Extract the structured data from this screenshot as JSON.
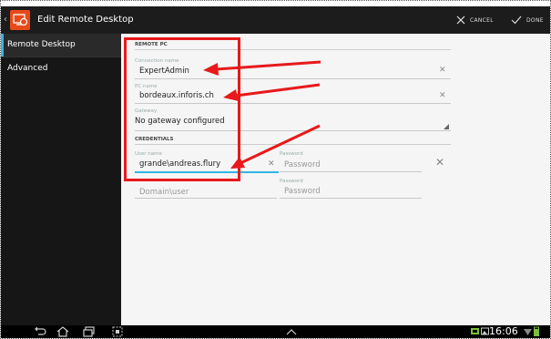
{
  "window": {
    "title": "Edit Remote Desktop",
    "cancel_label": "CANCEL",
    "done_label": "DONE"
  },
  "sidebar": {
    "items": [
      {
        "label": "Remote Desktop",
        "selected": true
      },
      {
        "label": "Advanced",
        "selected": false
      }
    ]
  },
  "form": {
    "remote_pc_header": "REMOTE PC",
    "connection_name": {
      "label": "Connection name",
      "value": "ExpertAdmin"
    },
    "pc_name": {
      "label": "PC name",
      "value": "bordeaux.inforis.ch"
    },
    "gateway": {
      "label": "Gateway",
      "value": "No gateway configured"
    },
    "credentials_header": "CREDENTIALS",
    "user_name": {
      "label": "User name",
      "value": "grande\\andreas.flury"
    },
    "password": {
      "label": "Password",
      "placeholder": "Password"
    },
    "domain_user": {
      "placeholder": "Domain\\user"
    },
    "password2": {
      "label": "Password",
      "placeholder": "Password"
    }
  },
  "status_bar": {
    "time": "16:06"
  },
  "colors": {
    "accent": "#33b5e5",
    "annotation": "#e8191b",
    "app_icon": "#e64a19",
    "action_bar": "#1c1c1c"
  },
  "icons": [
    "app-icon",
    "close-icon",
    "check-icon",
    "clear-icon",
    "back-icon",
    "home-icon",
    "recent-apps-icon",
    "screenshot-icon",
    "chevron-up-icon",
    "notification-icon",
    "battery-icon",
    "wifi-icon"
  ]
}
